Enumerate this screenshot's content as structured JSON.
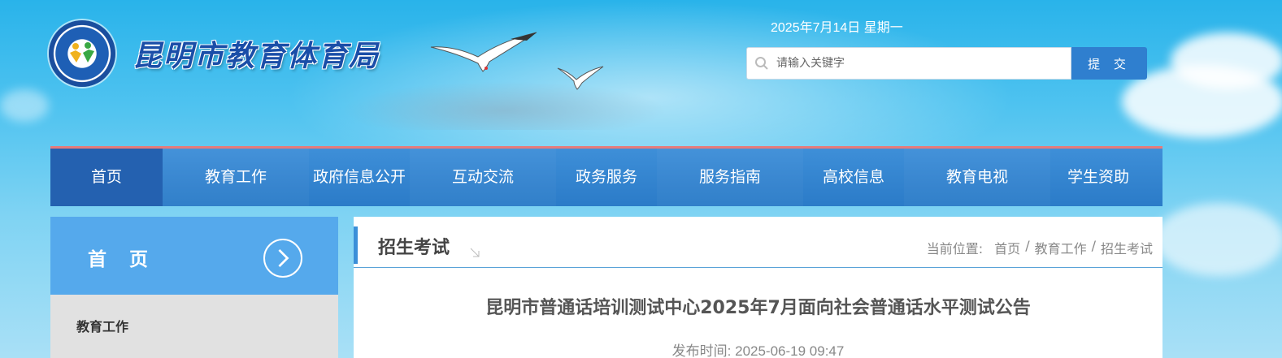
{
  "header": {
    "site_title": "昆明市教育体育局",
    "logo_ring_text": "昆明市教育体育局",
    "date": "2025年7月14日 星期一",
    "search": {
      "placeholder": "请输入关键字",
      "submit_label": "提 交"
    }
  },
  "nav": {
    "items": [
      {
        "label": "首页",
        "active": true
      },
      {
        "label": "教育工作"
      },
      {
        "label": "政府信息公开"
      },
      {
        "label": "互动交流"
      },
      {
        "label": "政务服务"
      },
      {
        "label": "服务指南"
      },
      {
        "label": "高校信息"
      },
      {
        "label": "教育电视"
      },
      {
        "label": "学生资助"
      }
    ]
  },
  "sidebar": {
    "title": "首 页",
    "sub_label": "教育工作"
  },
  "main": {
    "section_title": "招生考试",
    "breadcrumb": {
      "prefix": "当前位置:",
      "items": [
        "首页",
        "教育工作",
        "招生考试"
      ],
      "separator": "/"
    },
    "article_title": "昆明市普通话培训测试中心2025年7月面向社会普通话水平测试公告",
    "publish_label": "发布时间:",
    "publish_time": "2025-06-19 09:47"
  },
  "colors": {
    "nav_bg": "#2b7bc8",
    "nav_active": "#2461b0",
    "nav_top_border": "#e57b7b",
    "sidebar_head": "#55a9ec",
    "submit_btn": "#2f7fcf",
    "title_blue": "#1a4ea8"
  }
}
